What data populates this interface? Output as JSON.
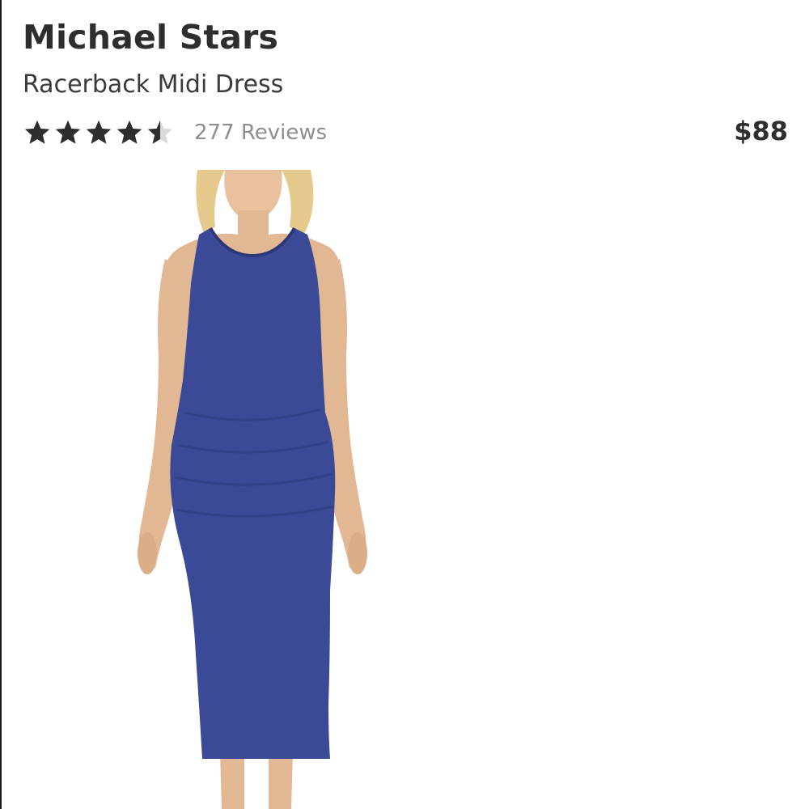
{
  "product": {
    "brand": "Michael Stars",
    "name": "Racerback Midi Dress",
    "rating": 4.5,
    "rating_max": 5,
    "reviews_label": "277 Reviews",
    "price": "$88"
  },
  "colors": {
    "star_filled": "#2e2e2e",
    "star_empty": "#d9d9d9",
    "dress": "#3a4a96",
    "skin": "#e2b894",
    "hair": "#e6c98d"
  },
  "icons": {
    "star": "star-icon",
    "half_star": "half-star-icon"
  },
  "image": {
    "subject": "product-photo"
  }
}
